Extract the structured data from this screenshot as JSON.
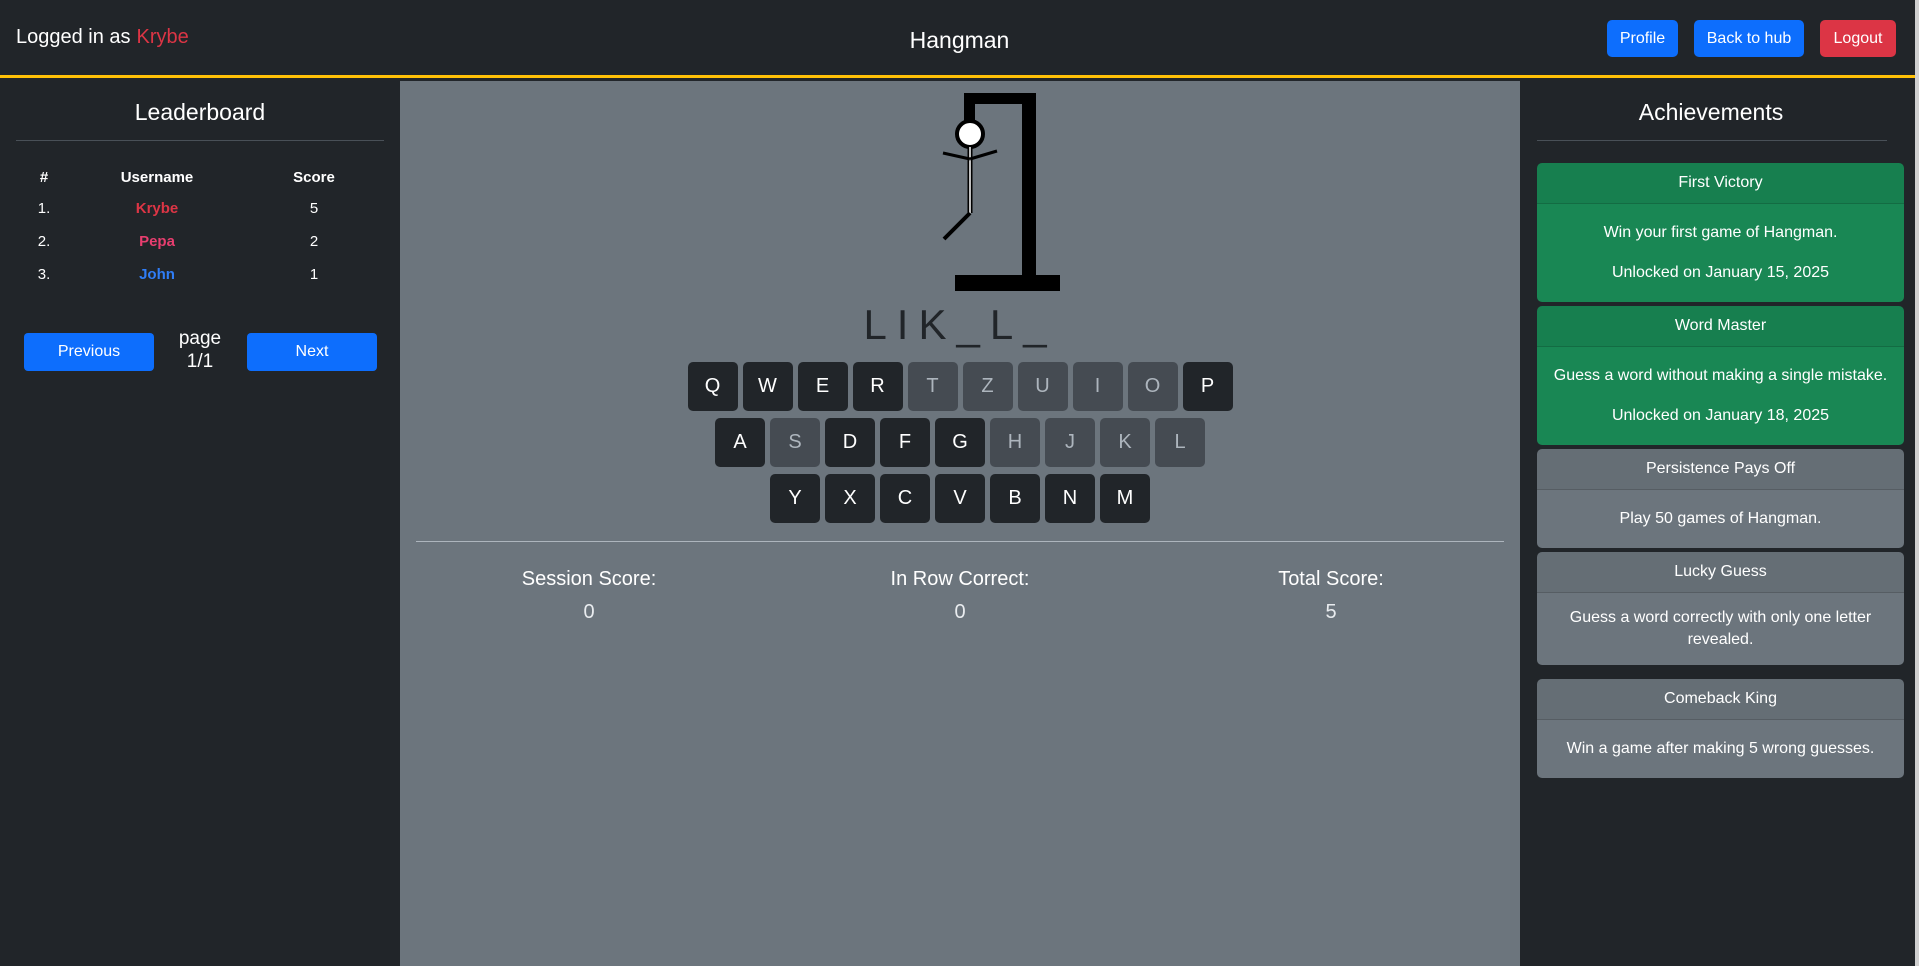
{
  "header": {
    "logged_prefix": "Logged in as",
    "username": "Krybe",
    "title": "Hangman",
    "profile_label": "Profile",
    "hub_label": "Back to hub",
    "logout_label": "Logout"
  },
  "leaderboard": {
    "title": "Leaderboard",
    "columns": [
      "#",
      "Username",
      "Score"
    ],
    "rows": [
      {
        "rank": "1.",
        "user": "Krybe",
        "score": "5",
        "color": "#dc3545"
      },
      {
        "rank": "2.",
        "user": "Pepa",
        "score": "2",
        "color": "#e83e6f"
      },
      {
        "rank": "3.",
        "user": "John",
        "score": "1",
        "color": "#2f7df6"
      }
    ],
    "prev_label": "Previous",
    "page_label": "page 1/1",
    "next_label": "Next"
  },
  "game": {
    "word": "LIK_L_",
    "keyboard_rows": [
      [
        "Q",
        "W",
        "E",
        "R",
        "T",
        "Z",
        "U",
        "I",
        "O",
        "P"
      ],
      [
        "A",
        "S",
        "D",
        "F",
        "G",
        "H",
        "J",
        "K",
        "L"
      ],
      [
        "Y",
        "X",
        "C",
        "V",
        "B",
        "N",
        "M"
      ]
    ],
    "used_keys": [
      "T",
      "Z",
      "U",
      "I",
      "O",
      "S",
      "H",
      "J",
      "K",
      "L"
    ],
    "stats": [
      {
        "label": "Session Score:",
        "value": "0"
      },
      {
        "label": "In Row Correct:",
        "value": "0"
      },
      {
        "label": "Total Score:",
        "value": "5"
      }
    ]
  },
  "achievements": {
    "title": "Achievements",
    "items": [
      {
        "name": "First Victory",
        "desc": "Win your first game of Hangman.",
        "date": "Unlocked on January 15, 2025",
        "unlocked": true
      },
      {
        "name": "Word Master",
        "desc": "Guess a word without making a single mistake.",
        "date": "Unlocked on January 18, 2025",
        "unlocked": true
      },
      {
        "name": "Persistence Pays Off",
        "desc": "Play 50 games of Hangman.",
        "date": "",
        "unlocked": false
      },
      {
        "name": "Lucky Guess",
        "desc": "Guess a word correctly with only one letter revealed.",
        "date": "",
        "unlocked": false
      },
      {
        "name": "Comeback King",
        "desc": "Win a game after making 5 wrong guesses.",
        "date": "",
        "unlocked": false
      }
    ]
  },
  "colors": {
    "accent": "#ffc107",
    "primary": "#0d6efd",
    "danger": "#dc3545",
    "success": "#198754"
  }
}
